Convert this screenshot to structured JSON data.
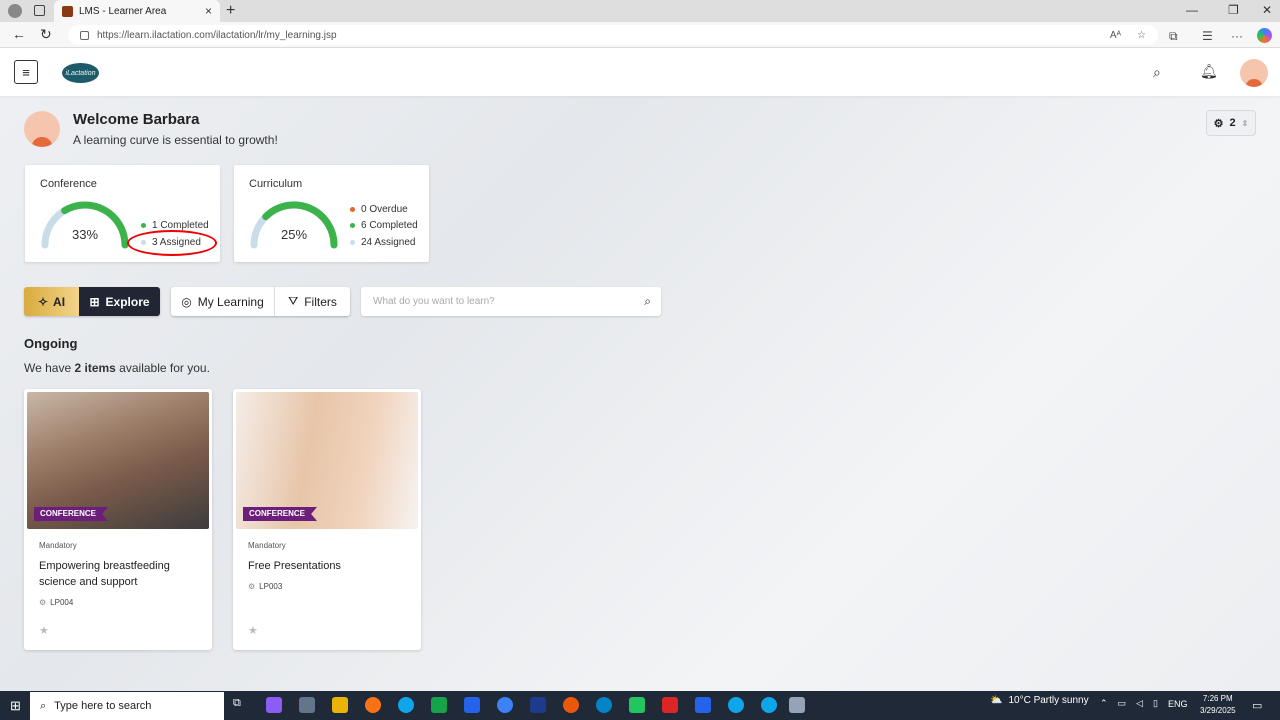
{
  "browser": {
    "tab_title": "LMS - Learner Area",
    "url": "https://learn.ilactation.com/ilactation/lr/my_learning.jsp"
  },
  "header": {
    "logo_text": "iLactation",
    "user_avatar": "user-avatar-icon"
  },
  "welcome": {
    "title": "Welcome Barbara",
    "tagline": "A learning curve is essential to growth!",
    "settings_count": "2"
  },
  "stats": {
    "conference": {
      "title": "Conference",
      "percent": "33%",
      "percent_value": 0.33,
      "completed": "1 Completed",
      "assigned": "3 Assigned"
    },
    "curriculum": {
      "title": "Curriculum",
      "percent": "25%",
      "percent_value": 0.25,
      "overdue": "0 Overdue",
      "completed": "6 Completed",
      "assigned": "24 Assigned"
    }
  },
  "toolbar": {
    "ai_label": "AI",
    "explore_label": "Explore",
    "mylearning_label": "My Learning",
    "filters_label": "Filters",
    "search_placeholder": "What do you want to learn?"
  },
  "ongoing": {
    "heading": "Ongoing",
    "avail_prefix": "We have ",
    "avail_count": "2 items",
    "avail_suffix": " available for you."
  },
  "courses": [
    {
      "badge": "CONFERENCE",
      "mandatory": "Mandatory",
      "title": "Empowering breastfeeding science and support",
      "code": "LP004"
    },
    {
      "badge": "CONFERENCE",
      "mandatory": "Mandatory",
      "title": "Free Presentations",
      "code": "LP003"
    }
  ],
  "taskbar": {
    "search_placeholder": "Type here to search",
    "weather": "10°C  Partly sunny",
    "lang": "ENG",
    "time": "7:26 PM",
    "date": "3/29/2025"
  },
  "colors": {
    "completed": "#3bb34a",
    "assigned": "#c9dde8",
    "overdue": "#e8632b",
    "badge": "#6b1f7b",
    "explore_bg": "#222634",
    "annotation": "#e00000"
  }
}
